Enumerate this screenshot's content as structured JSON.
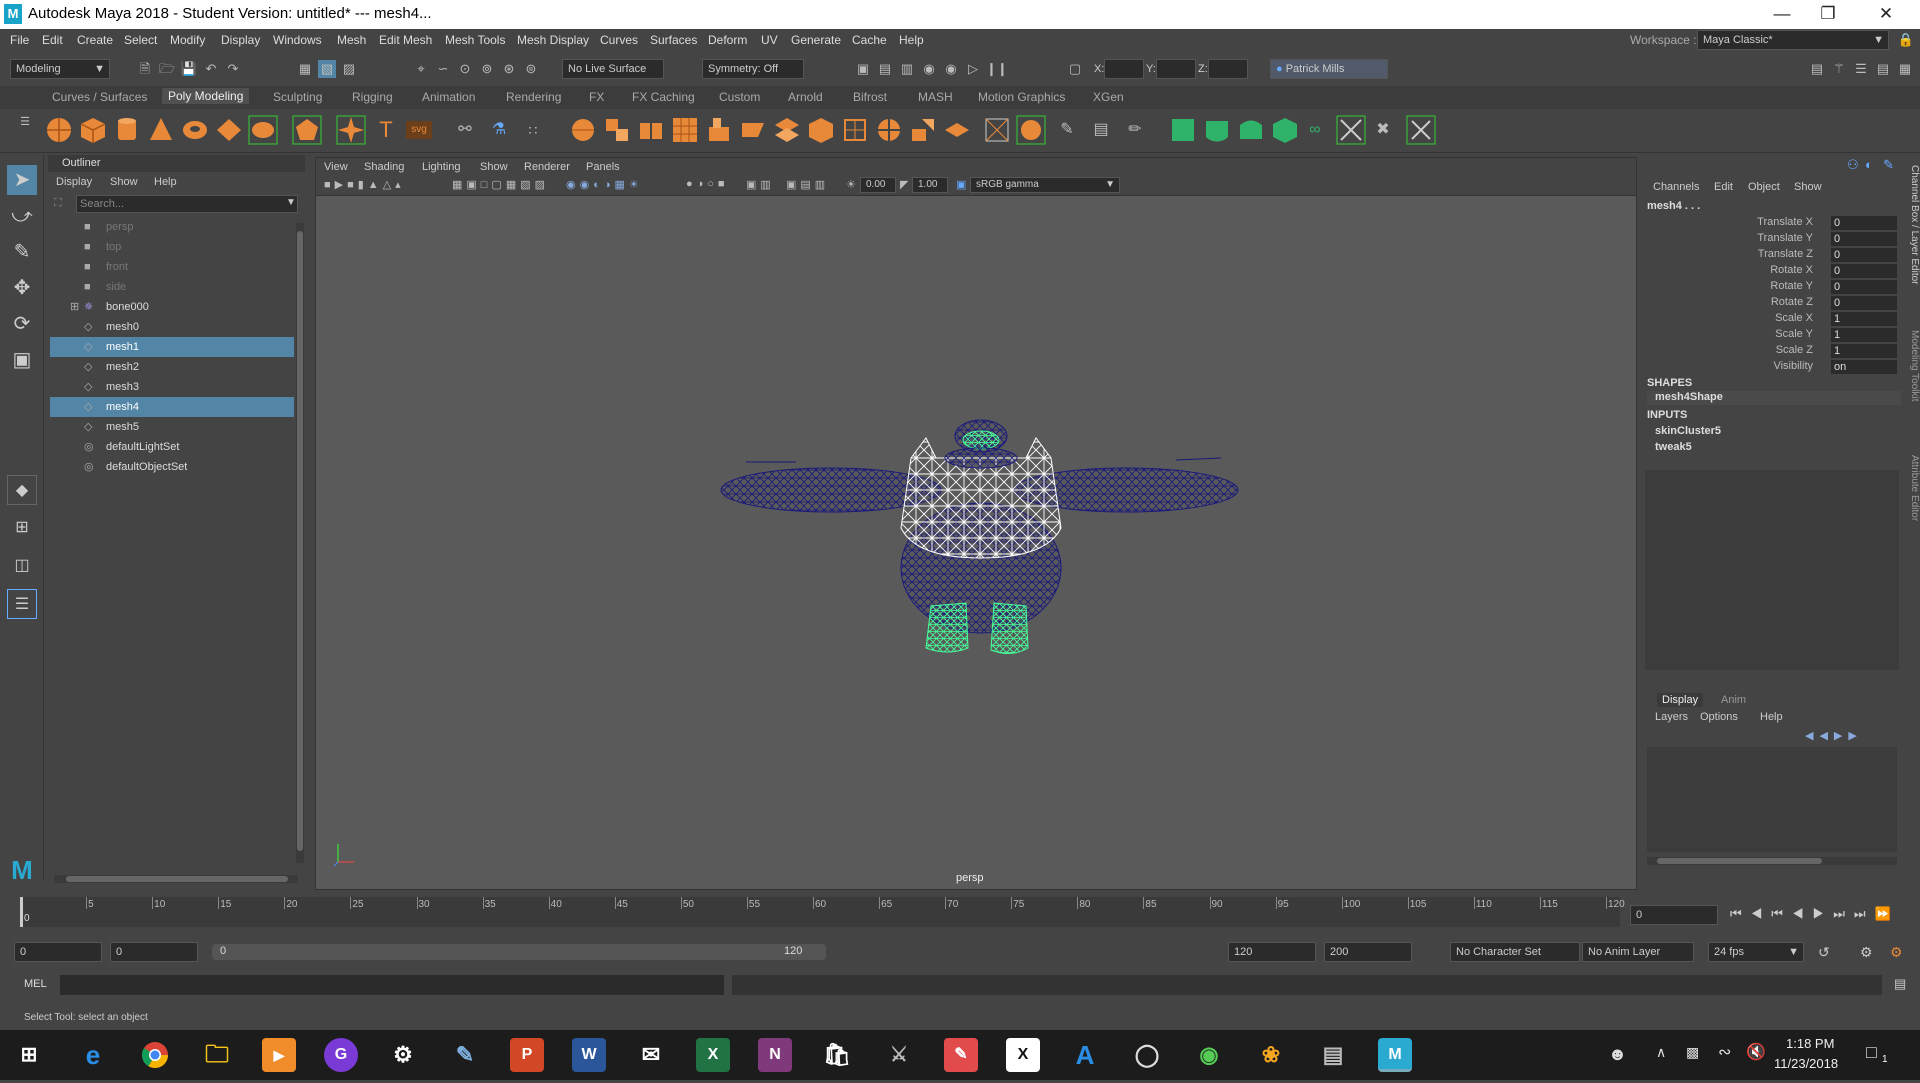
{
  "window": {
    "title": "Autodesk Maya 2018 - Student Version: untitled*   ---   mesh4...",
    "controls": [
      "minimize-icon",
      "restore-icon",
      "close-icon"
    ]
  },
  "menubar": {
    "items": [
      "File",
      "Edit",
      "Create",
      "Select",
      "Modify",
      "Display",
      "Windows",
      "Mesh",
      "Edit Mesh",
      "Mesh Tools",
      "Mesh Display",
      "Curves",
      "Surfaces",
      "Deform",
      "UV",
      "Generate",
      "Cache",
      "Help"
    ],
    "workspace_label": "Workspace :",
    "workspace_value": "Maya Classic*"
  },
  "toolbar": {
    "menuset": "Modeling",
    "live_surface": "No Live Surface",
    "symmetry": "Symmetry: Off",
    "x_label": "X:",
    "y_label": "Y:",
    "z_label": "Z:",
    "user": "Patrick Mills"
  },
  "shelf_tabs": [
    "Curves / Surfaces",
    "Poly Modeling",
    "Sculpting",
    "Rigging",
    "Animation",
    "Rendering",
    "FX",
    "FX Caching",
    "Custom",
    "Arnold",
    "Bifrost",
    "MASH",
    "Motion Graphics",
    "XGen"
  ],
  "shelf_active": "Poly Modeling",
  "outliner": {
    "title": "Outliner",
    "menu": [
      "Display",
      "Show",
      "Help"
    ],
    "search_placeholder": "Search...",
    "items": [
      {
        "label": "persp",
        "icon": "camera-icon",
        "state": "dim"
      },
      {
        "label": "top",
        "icon": "camera-icon",
        "state": "dim"
      },
      {
        "label": "front",
        "icon": "camera-icon",
        "state": "dim"
      },
      {
        "label": "side",
        "icon": "camera-icon",
        "state": "dim"
      },
      {
        "label": "bone000",
        "icon": "joint-icon",
        "state": "normal"
      },
      {
        "label": "mesh0",
        "icon": "mesh-icon",
        "state": "normal"
      },
      {
        "label": "mesh1",
        "icon": "mesh-icon",
        "state": "selected"
      },
      {
        "label": "mesh2",
        "icon": "mesh-icon",
        "state": "normal"
      },
      {
        "label": "mesh3",
        "icon": "mesh-icon",
        "state": "normal"
      },
      {
        "label": "mesh4",
        "icon": "mesh-icon",
        "state": "selected"
      },
      {
        "label": "mesh5",
        "icon": "mesh-icon",
        "state": "normal"
      },
      {
        "label": "defaultLightSet",
        "icon": "set-icon",
        "state": "normal"
      },
      {
        "label": "defaultObjectSet",
        "icon": "set-icon",
        "state": "normal"
      }
    ]
  },
  "viewport": {
    "menu": [
      "View",
      "Shading",
      "Lighting",
      "Show",
      "Renderer",
      "Panels"
    ],
    "exposure": "0.00",
    "gamma": "1.00",
    "color_space": "sRGB gamma",
    "camera_label": "persp"
  },
  "channel_box": {
    "menu": [
      "Channels",
      "Edit",
      "Object",
      "Show"
    ],
    "object": "mesh4 . . .",
    "attributes": [
      {
        "name": "Translate X",
        "value": "0"
      },
      {
        "name": "Translate Y",
        "value": "0"
      },
      {
        "name": "Translate Z",
        "value": "0"
      },
      {
        "name": "Rotate X",
        "value": "0"
      },
      {
        "name": "Rotate Y",
        "value": "0"
      },
      {
        "name": "Rotate Z",
        "value": "0"
      },
      {
        "name": "Scale X",
        "value": "1"
      },
      {
        "name": "Scale Y",
        "value": "1"
      },
      {
        "name": "Scale Z",
        "value": "1"
      },
      {
        "name": "Visibility",
        "value": "on"
      }
    ],
    "shapes_header": "SHAPES",
    "shapes": [
      "mesh4Shape"
    ],
    "inputs_header": "INPUTS",
    "inputs": [
      "skinCluster5",
      "tweak5"
    ],
    "side_tabs": [
      "Channel Box / Layer Editor",
      "Modeling Toolkit",
      "Attribute Editor"
    ],
    "layer_tabs": [
      "Display",
      "Anim"
    ],
    "layer_menu": [
      "Layers",
      "Options",
      "Help"
    ]
  },
  "timeline": {
    "ticks": [
      "5",
      "10",
      "15",
      "20",
      "25",
      "30",
      "35",
      "40",
      "45",
      "50",
      "55",
      "60",
      "65",
      "70",
      "75",
      "80",
      "85",
      "90",
      "95",
      "100",
      "105",
      "110",
      "115",
      "120"
    ],
    "start_marker": "0",
    "current_frame": "0",
    "range_start": "0",
    "playback_start": "0",
    "slider_start": "0",
    "slider_end": "120",
    "playback_end": "120",
    "range_end": "200",
    "character_set": "No Character Set",
    "anim_layer": "No Anim Layer",
    "fps": "24 fps"
  },
  "command": {
    "language": "MEL",
    "help_text": "Select Tool: select an object"
  },
  "taskbar": {
    "time": "1:18 PM",
    "date": "11/23/2018",
    "notification_count": "1"
  },
  "colors": {
    "selection": "#5285a6",
    "wire_blue": "#1a1a7a",
    "wire_white": "#ffffff",
    "wire_green": "#44ff99",
    "viewport_bg": "#5a5a5a"
  }
}
